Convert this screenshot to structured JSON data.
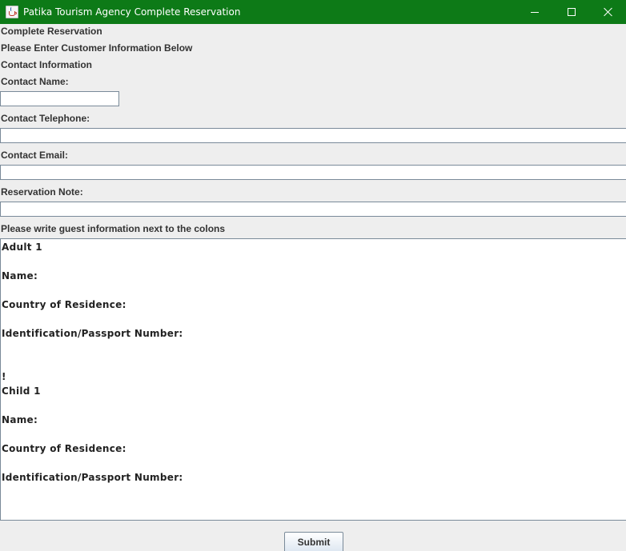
{
  "window": {
    "title": "Patika Tourism Agency Complete Reservation",
    "icon": "java-cup-icon",
    "titlebar_color": "#0d7a17"
  },
  "form": {
    "heading": "Complete Reservation",
    "instruction": "Please Enter Customer Information Below",
    "section_title": "Contact Information",
    "contact_name_label": "Contact Name:",
    "contact_name_value": "",
    "contact_telephone_label": "Contact Telephone:",
    "contact_telephone_value": "",
    "contact_email_label": "Contact Email:",
    "contact_email_value": "",
    "reservation_note_label": "Reservation Note:",
    "reservation_note_value": "",
    "guest_instruction": "Please write guest information next to the colons"
  },
  "guests": {
    "adult_title": "Adult 1",
    "adult_name": "Name:",
    "adult_country": "Country of Residence:",
    "adult_id": "Identification/Passport Number:",
    "separator": "!",
    "child_title": "Child 1",
    "child_name": "Name:",
    "child_country": "Country of Residence:",
    "child_id": "Identification/Passport Number:"
  },
  "actions": {
    "submit_label": "Submit"
  }
}
